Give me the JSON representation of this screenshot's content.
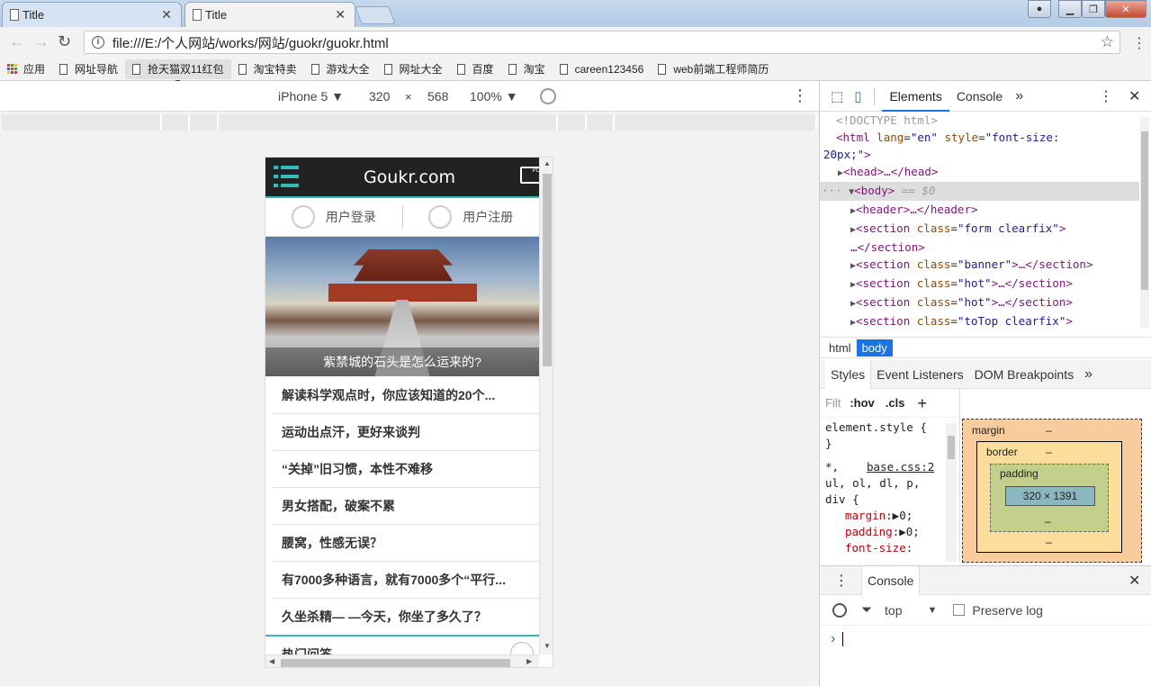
{
  "browser": {
    "tabs": [
      {
        "title": "Title"
      },
      {
        "title": "Title"
      }
    ],
    "url": "file:///E:/个人网站/works/网站/guokr/guokr.html"
  },
  "bookmarks": [
    "应用",
    "网址导航",
    "抢天猫双11红包",
    "淘宝特卖",
    "游戏大全",
    "网址大全",
    "百度",
    "淘宝",
    "careen123456",
    "web前端工程师简历"
  ],
  "device_toolbar": {
    "device": "iPhone 5",
    "width": "320",
    "times": "×",
    "height": "568",
    "zoom": "100%"
  },
  "phone": {
    "site_title": "Goukr.com",
    "pc_label": "PC",
    "login": "用户登录",
    "register": "用户注册",
    "banner_caption": "紫禁城的石头是怎么运来的?",
    "articles": [
      "解读科学观点时，你应该知道的20个...",
      "运动出点汗，更好来谈判",
      "“关掉”旧习惯，本性不难移",
      "男女搭配，破案不累",
      "腰窝，性感无误？",
      "有7000多种语言，就有7000多个“平行...",
      "久坐杀精— —今天，你坐了多久了？"
    ],
    "hot_section": "热门问答"
  },
  "devtools": {
    "tabs": [
      "Elements",
      "Console"
    ],
    "dom": {
      "doctype": "<!DOCTYPE html>",
      "html_open": "<html",
      "html_lang_attr": "lang",
      "html_lang_val": "\"en\"",
      "html_style_attr": "style",
      "html_style_val": "\"font-size:",
      "html_style_val2": "20px;\"",
      "head": "<head>…</head>",
      "body": "<body>",
      "body_eq": "== $0",
      "header": "<header>…</header>",
      "sections": [
        {
          "cls": "\"form clearfix\"",
          "wrap": true
        },
        {
          "cls": "\"banner\"",
          "wrap": false
        },
        {
          "cls": "\"hot\"",
          "wrap": false
        },
        {
          "cls": "\"hot\"",
          "wrap": false
        },
        {
          "cls": "\"toTop clearfix\"",
          "wrap": true
        }
      ]
    },
    "breadcrumbs": [
      "html",
      "body"
    ],
    "styles_tabs": [
      "Styles",
      "Event Listeners",
      "DOM Breakpoints"
    ],
    "filter_placeholder": "Filt",
    "hov": ":hov",
    "cls": ".cls",
    "styles_rules": {
      "element_style": "element.style {",
      "close_brace": "}",
      "selector": "*,",
      "source": "base.css:2",
      "selector2": "ul, ol, dl, p,",
      "selector3": "div {",
      "props": [
        {
          "name": "margin",
          "value": "0;"
        },
        {
          "name": "padding",
          "value": "0;"
        },
        {
          "name": "font-size",
          "value": ""
        }
      ]
    },
    "box_model": {
      "margin": "margin",
      "border": "border",
      "padding": "padding",
      "dash": "–",
      "content": "320 × 1391"
    },
    "console": {
      "tab": "Console",
      "context": "top",
      "preserve_log": "Preserve log",
      "prompt": "›"
    }
  }
}
